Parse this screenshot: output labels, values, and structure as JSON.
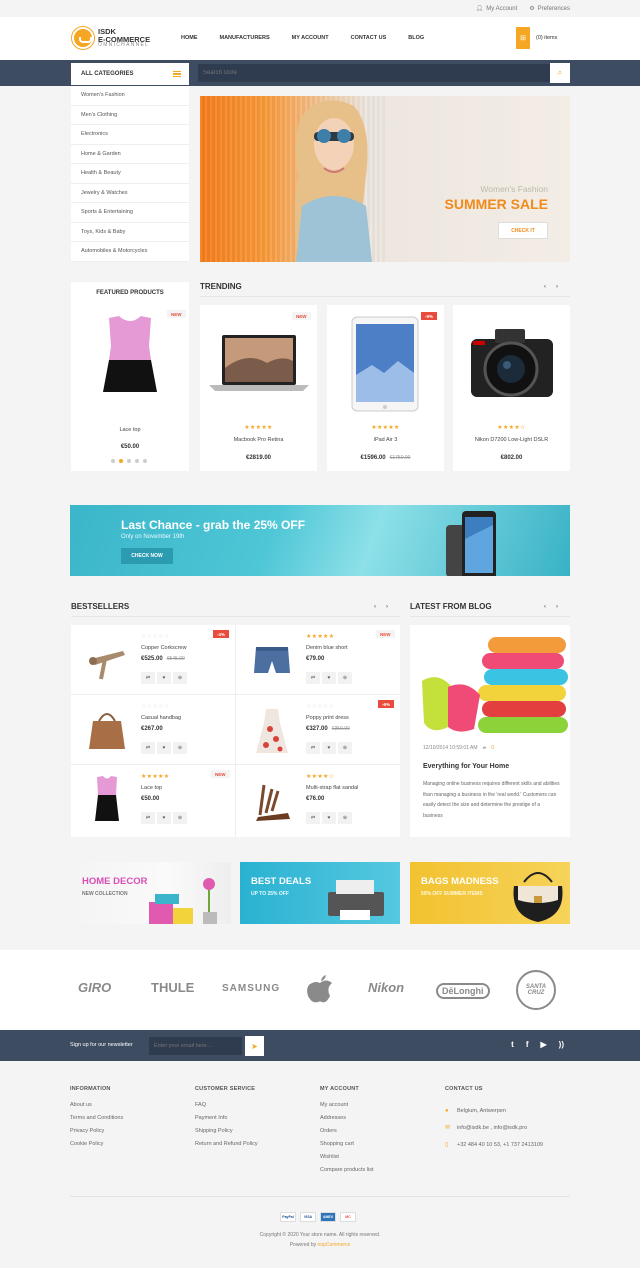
{
  "topbar": {
    "my_account": "My Account",
    "preferences": "Preferences"
  },
  "logo": {
    "line1": "ISDK",
    "line2": "E-COMMERCE",
    "line3": "OMNICHANNEL"
  },
  "nav": [
    "HOME",
    "MANUFACTURERS",
    "MY ACCOUNT",
    "CONTACT US",
    "BLOG"
  ],
  "cart": {
    "label": "(0) items"
  },
  "categories": {
    "title": "ALL CATEGORIES",
    "items": [
      "Women's Fashion",
      "Men's Clothing",
      "Electronics",
      "Home & Garden",
      "Health & Beauty",
      "Jewelry & Watches",
      "Sports & Entertaining",
      "Toys, Kids & Baby",
      "Automobiles & Motorcycles"
    ]
  },
  "search": {
    "placeholder": "Search store"
  },
  "hero": {
    "subtitle": "Women's Fashion",
    "title": "SUMMER SALE",
    "button": "CHECK IT"
  },
  "featured": {
    "title": "FEATURED PRODUCTS",
    "badge": "NEW",
    "product": {
      "name": "Lace top",
      "price": "€50.00"
    }
  },
  "trending": {
    "title": "TRENDING",
    "products": [
      {
        "name": "Macbook Pro Retina",
        "price": "€2819.00",
        "old_price": "",
        "badge": "NEW",
        "stars": "★★★★★"
      },
      {
        "name": "iPad Air 3",
        "price": "€1596.00",
        "old_price": "€1750.00",
        "badge": "-9%",
        "stars": "★★★★★"
      },
      {
        "name": "Nikon D7200 Low-Light DSLR",
        "price": "€802.00",
        "old_price": "",
        "badge": "",
        "stars": "★★★★☆"
      }
    ]
  },
  "promo_banner": {
    "title": "Last Chance - grab the 25% OFF",
    "subtitle": "Only on November 19th",
    "button": "CHECK NOW"
  },
  "bestsellers": {
    "title": "BESTSELLERS",
    "items": [
      {
        "name": "Copper Corkscrew",
        "price": "€525.00",
        "old_price": "€545.00",
        "badge": "-4%",
        "stars": "☆☆☆☆☆"
      },
      {
        "name": "Denim blue short",
        "price": "€79.00",
        "old_price": "",
        "badge": "NEW",
        "stars": "★★★★★"
      },
      {
        "name": "Casual handbag",
        "price": "€267.00",
        "old_price": "",
        "badge": "",
        "stars": "☆☆☆☆☆"
      },
      {
        "name": "Poppy print dress",
        "price": "€327.00",
        "old_price": "€350.00",
        "badge": "-6%",
        "stars": "☆☆☆☆☆"
      },
      {
        "name": "Lace top",
        "price": "€50.00",
        "old_price": "",
        "badge": "NEW",
        "stars": "★★★★★"
      },
      {
        "name": "Multi-strap flat sandal",
        "price": "€76.00",
        "old_price": "",
        "badge": "",
        "stars": "★★★★☆"
      }
    ]
  },
  "blog": {
    "title": "LATEST FROM BLOG",
    "date": "12/10/2014 10:59:01 AM",
    "comments": "0",
    "post_title": "Everything for Your Home",
    "excerpt": "Managing online business requires different skills and abilities than managing a business in the 'real world.' Customers can easily detect the size and determine the prestige of a business"
  },
  "promos": [
    {
      "title": "HOME DECOR",
      "subtitle": "NEW COLLECTION"
    },
    {
      "title": "BEST DEALS",
      "subtitle": "UP TO 25% OFF"
    },
    {
      "title": "BAGS MADNESS",
      "subtitle": "50% OFF SUMMER ITEMS"
    }
  ],
  "brands": [
    "GIRO",
    "THULE",
    "SAMSUNG",
    "Nikon",
    "DēLonghi",
    "SANTA CRUZ"
  ],
  "newsletter": {
    "label": "Sign up for our newsletter",
    "placeholder": "Enter your email here..."
  },
  "footer": {
    "information": {
      "title": "INFORMATION",
      "links": [
        "About us",
        "Terms and Conditions",
        "Privacy Policy",
        "Cookie Policy"
      ]
    },
    "customer_service": {
      "title": "CUSTOMER SERVICE",
      "links": [
        "FAQ",
        "Payment Info",
        "Shipping Policy",
        "Return and Refund Policy"
      ]
    },
    "my_account": {
      "title": "MY ACCOUNT",
      "links": [
        "My account",
        "Addresses",
        "Orders",
        "Shopping cart",
        "Wishlist",
        "Compare products list"
      ]
    },
    "contact": {
      "title": "CONTACT US",
      "address": "Belgium, Antwerpen",
      "email": "info@isdk.be , info@isdk.pro",
      "phone": "+32 484 40 10 53, +1 737 2413109"
    },
    "payments": [
      "PayPal",
      "VISA",
      "AMEX",
      "MC"
    ],
    "copyright": "Copyright © 2020 Your store name. All rights reserved.",
    "powered_prefix": "Powered by",
    "powered_link": "nopCommerce"
  },
  "colors": {
    "accent": "#f5a623",
    "navy": "#3e4c62",
    "sale": "#e94b3c",
    "teal": "#3bb5c9"
  }
}
